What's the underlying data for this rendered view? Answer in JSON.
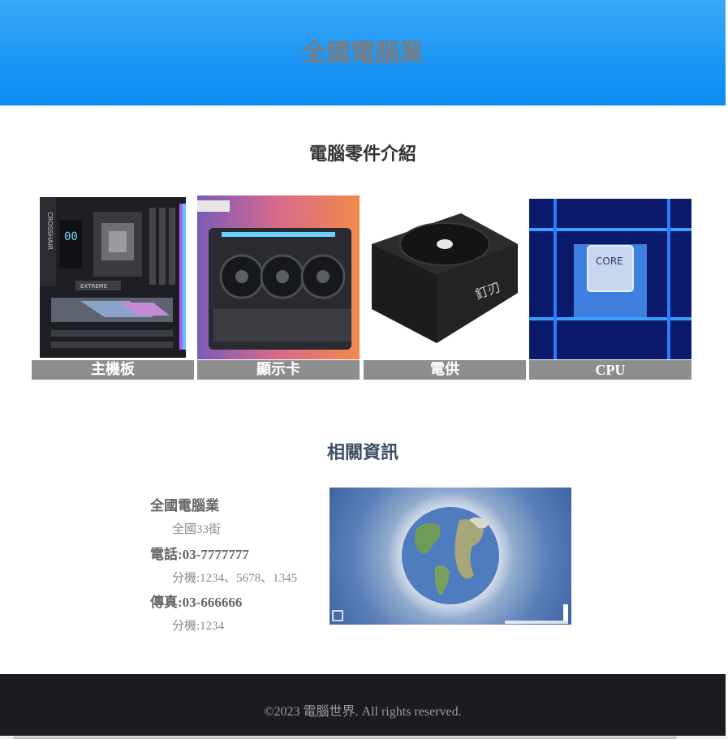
{
  "header": {
    "title": "全國電腦業"
  },
  "parts_section": {
    "title": "電腦零件介紹",
    "items": [
      {
        "label": "主機板",
        "icon": "motherboard-image"
      },
      {
        "label": "顯示卡",
        "icon": "graphics-card-image"
      },
      {
        "label": "電供",
        "icon": "power-supply-image"
      },
      {
        "label": "CPU",
        "icon": "cpu-image"
      }
    ]
  },
  "info_section": {
    "title": "相關資訊",
    "company": "全國電腦業",
    "address": "全國33街",
    "phone": "電話:03-7777777",
    "phone_ext": "分機:1234、5678、1345",
    "fax": "傳真:03-666666",
    "fax_ext": "分機:1234"
  },
  "footer": {
    "copyright": "©2023 電腦世界. All rights reserved."
  },
  "colors": {
    "header_blue": "#1d97f5",
    "caption_gray": "#8e8e8e",
    "footer_dark": "#1b1c20"
  }
}
